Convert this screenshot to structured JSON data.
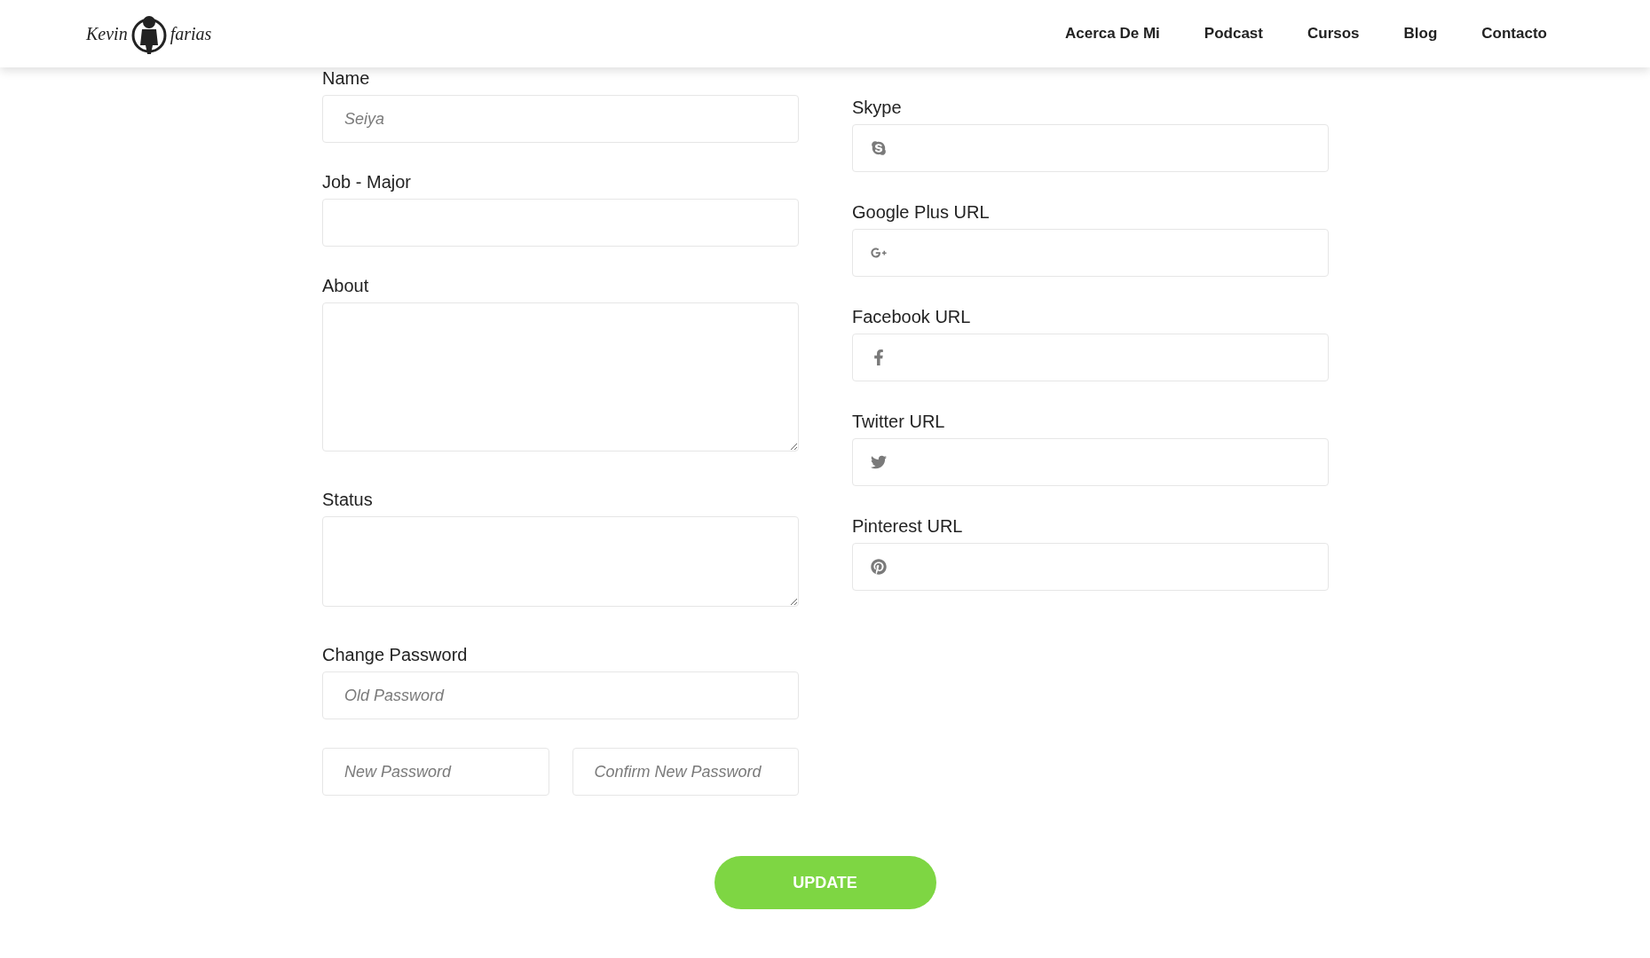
{
  "header": {
    "logo": {
      "left": "Kevin",
      "right": "farias"
    },
    "nav": [
      "Acerca De Mi",
      "Podcast",
      "Cursos",
      "Blog",
      "Contacto"
    ]
  },
  "left_fields": [
    {
      "kind": "input",
      "label": "Name",
      "placeholder": "Seiya"
    },
    {
      "kind": "input",
      "label": "Job - Major"
    },
    {
      "kind": "longtext",
      "label": "About"
    },
    {
      "kind": "textarea",
      "label": "Status"
    }
  ],
  "password": {
    "label": "Change Password",
    "old_placeholder": "Old Password",
    "new_placeholder": "New Password",
    "confirm_placeholder": "Confirm New Password"
  },
  "social_fields": [
    {
      "label": "Skype",
      "kind": "skype"
    },
    {
      "label": "Google Plus URL",
      "kind": "googleplus"
    },
    {
      "label": "Facebook URL",
      "kind": "facebook"
    },
    {
      "label": "Twitter URL",
      "kind": "twitter"
    },
    {
      "label": "Pinterest URL",
      "kind": "pinterest"
    }
  ],
  "submit": "UPDATE"
}
